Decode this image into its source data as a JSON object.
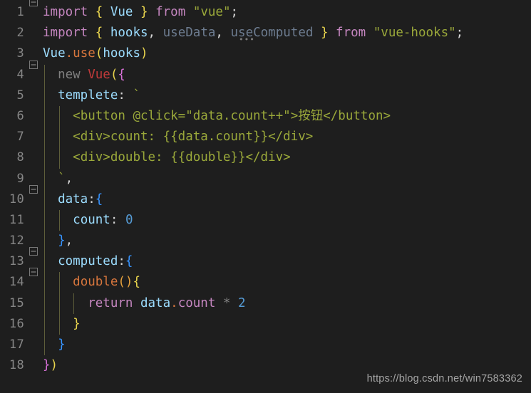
{
  "editor": {
    "background_color": "#1e1e1e",
    "gutter_text_color": "#868686",
    "indent_guide_color": "#6a6a3f",
    "fold_marker_glyph": "minus-box",
    "watermark": "https://blog.csdn.net/win7583362"
  },
  "lines": [
    {
      "number": "1",
      "fold": true,
      "indent_guides": 0,
      "text": "import { Vue } from \"vue\";",
      "tokens": [
        {
          "t": "import",
          "c": "kw"
        },
        {
          "t": " ",
          "c": "plain"
        },
        {
          "t": "{",
          "c": "b-yellow"
        },
        {
          "t": " ",
          "c": "plain"
        },
        {
          "t": "Vue",
          "c": "var"
        },
        {
          "t": " ",
          "c": "plain"
        },
        {
          "t": "}",
          "c": "b-yellow"
        },
        {
          "t": " ",
          "c": "plain"
        },
        {
          "t": "from",
          "c": "kw"
        },
        {
          "t": " ",
          "c": "plain"
        },
        {
          "t": "\"vue\"",
          "c": "strg"
        },
        {
          "t": ";",
          "c": "plain"
        }
      ]
    },
    {
      "number": "2",
      "fold": false,
      "indent_guides": 0,
      "text": "import { hooks, useData, useComputed } from \"vue-hooks\";",
      "tokens": [
        {
          "t": "import",
          "c": "kw"
        },
        {
          "t": " ",
          "c": "plain"
        },
        {
          "t": "{",
          "c": "b-yellow"
        },
        {
          "t": " ",
          "c": "plain"
        },
        {
          "t": "hooks",
          "c": "var"
        },
        {
          "t": ",",
          "c": "plain"
        },
        {
          "t": " ",
          "c": "plain"
        },
        {
          "t": "useData",
          "c": "dim"
        },
        {
          "t": ",",
          "c": "plain"
        },
        {
          "t": " ",
          "c": "plain"
        },
        {
          "t": "useComputed",
          "c": "dim"
        },
        {
          "t": " ",
          "c": "plain"
        },
        {
          "t": "}",
          "c": "b-yellow"
        },
        {
          "t": " ",
          "c": "plain"
        },
        {
          "t": "from",
          "c": "kw"
        },
        {
          "t": " ",
          "c": "plain"
        },
        {
          "t": "\"vue-hooks\"",
          "c": "strg"
        },
        {
          "t": ";",
          "c": "plain"
        }
      ]
    },
    {
      "number": "3",
      "fold": false,
      "indent_guides": 0,
      "text": "Vue.use(hooks)",
      "tokens": [
        {
          "t": "Vue",
          "c": "var"
        },
        {
          "t": ".",
          "c": "dot"
        },
        {
          "t": "use",
          "c": "fnorange"
        },
        {
          "t": "(",
          "c": "b-yellow"
        },
        {
          "t": "hooks",
          "c": "var"
        },
        {
          "t": ")",
          "c": "b-yellow"
        }
      ]
    },
    {
      "number": "4",
      "fold": true,
      "indent_guides": 1,
      "text": "new Vue({",
      "tokens": [
        {
          "t": "  ",
          "c": "plain"
        },
        {
          "t": "new",
          "c": "gray"
        },
        {
          "t": " ",
          "c": "plain"
        },
        {
          "t": "Vue",
          "c": "cls"
        },
        {
          "t": "(",
          "c": "b-yellow"
        },
        {
          "t": "{",
          "c": "b-pink"
        }
      ]
    },
    {
      "number": "5",
      "fold": false,
      "indent_guides": 1,
      "text": "templete: `",
      "tokens": [
        {
          "t": "  ",
          "c": "plain"
        },
        {
          "t": "templete",
          "c": "var"
        },
        {
          "t": ":",
          "c": "plain"
        },
        {
          "t": " ",
          "c": "plain"
        },
        {
          "t": "`",
          "c": "strg"
        }
      ]
    },
    {
      "number": "6",
      "fold": false,
      "indent_guides": 2,
      "text": "<button @click=\"data.count++\">按钮</button>",
      "tokens": [
        {
          "t": "    ",
          "c": "plain"
        },
        {
          "t": "<button @click=\"data.count++\">按钮</button>",
          "c": "strg"
        }
      ]
    },
    {
      "number": "7",
      "fold": false,
      "indent_guides": 2,
      "text": "<div>count: {{data.count}}</div>",
      "tokens": [
        {
          "t": "    ",
          "c": "plain"
        },
        {
          "t": "<div>count: {{data.count}}</div>",
          "c": "strg"
        }
      ]
    },
    {
      "number": "8",
      "fold": false,
      "indent_guides": 2,
      "text": "<div>double: {{double}}</div>",
      "tokens": [
        {
          "t": "    ",
          "c": "plain"
        },
        {
          "t": "<div>double: {{double}}</div>",
          "c": "strg"
        }
      ]
    },
    {
      "number": "9",
      "fold": false,
      "indent_guides": 1,
      "text": "`,",
      "tokens": [
        {
          "t": "  ",
          "c": "plain"
        },
        {
          "t": "`",
          "c": "strg"
        },
        {
          "t": ",",
          "c": "plain"
        }
      ]
    },
    {
      "number": "10",
      "fold": true,
      "indent_guides": 1,
      "text": "data:{",
      "tokens": [
        {
          "t": "  ",
          "c": "plain"
        },
        {
          "t": "data",
          "c": "var"
        },
        {
          "t": ":",
          "c": "plain"
        },
        {
          "t": "{",
          "c": "b-blue"
        }
      ]
    },
    {
      "number": "11",
      "fold": false,
      "indent_guides": 2,
      "text": "count: 0",
      "tokens": [
        {
          "t": "    ",
          "c": "plain"
        },
        {
          "t": "count",
          "c": "var"
        },
        {
          "t": ":",
          "c": "plain"
        },
        {
          "t": " ",
          "c": "plain"
        },
        {
          "t": "0",
          "c": "num"
        }
      ]
    },
    {
      "number": "12",
      "fold": false,
      "indent_guides": 1,
      "text": "},",
      "tokens": [
        {
          "t": "  ",
          "c": "plain"
        },
        {
          "t": "}",
          "c": "b-blue"
        },
        {
          "t": ",",
          "c": "plain"
        }
      ]
    },
    {
      "number": "13",
      "fold": true,
      "indent_guides": 1,
      "text": "computed:{",
      "tokens": [
        {
          "t": "  ",
          "c": "plain"
        },
        {
          "t": "computed",
          "c": "var"
        },
        {
          "t": ":",
          "c": "plain"
        },
        {
          "t": "{",
          "c": "b-blue"
        }
      ]
    },
    {
      "number": "14",
      "fold": true,
      "indent_guides": 2,
      "text": "double(){",
      "tokens": [
        {
          "t": "    ",
          "c": "plain"
        },
        {
          "t": "double",
          "c": "fnorange"
        },
        {
          "t": "(",
          "c": "b-orange"
        },
        {
          "t": ")",
          "c": "b-orange"
        },
        {
          "t": "{",
          "c": "b-yellow"
        }
      ]
    },
    {
      "number": "15",
      "fold": false,
      "indent_guides": 3,
      "text": "return data.count * 2",
      "tokens": [
        {
          "t": "      ",
          "c": "plain"
        },
        {
          "t": "return",
          "c": "kw"
        },
        {
          "t": " ",
          "c": "plain"
        },
        {
          "t": "data",
          "c": "var"
        },
        {
          "t": ".",
          "c": "dot"
        },
        {
          "t": "count",
          "c": "kw"
        },
        {
          "t": " ",
          "c": "plain"
        },
        {
          "t": "*",
          "c": "gray"
        },
        {
          "t": " ",
          "c": "plain"
        },
        {
          "t": "2",
          "c": "num"
        }
      ]
    },
    {
      "number": "16",
      "fold": false,
      "indent_guides": 2,
      "text": "}",
      "tokens": [
        {
          "t": "    ",
          "c": "plain"
        },
        {
          "t": "}",
          "c": "b-yellow"
        }
      ]
    },
    {
      "number": "17",
      "fold": false,
      "indent_guides": 1,
      "text": "}",
      "tokens": [
        {
          "t": "  ",
          "c": "plain"
        },
        {
          "t": "}",
          "c": "b-blue"
        }
      ]
    },
    {
      "number": "18",
      "fold": false,
      "indent_guides": 0,
      "text": "})",
      "tokens": [
        {
          "t": "}",
          "c": "b-pink"
        },
        {
          "t": ")",
          "c": "b-yellow"
        }
      ]
    }
  ]
}
